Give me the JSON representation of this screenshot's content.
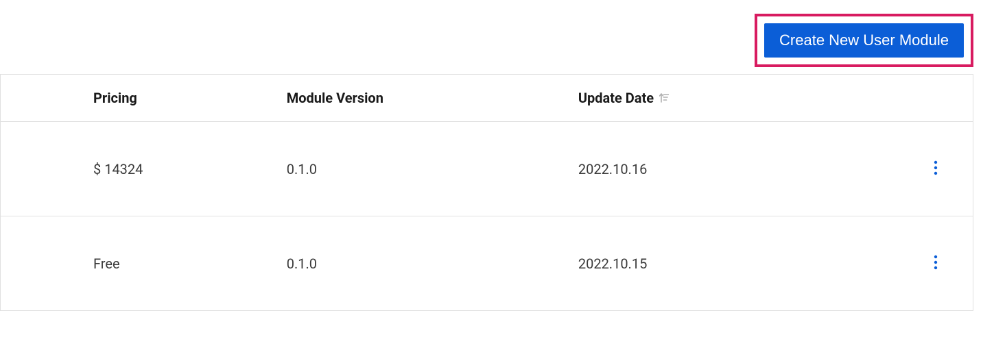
{
  "header": {
    "create_button_label": "Create New User Module"
  },
  "table": {
    "columns": {
      "pricing": "Pricing",
      "version": "Module Version",
      "update_date": "Update Date"
    },
    "rows": [
      {
        "pricing": "$ 14324",
        "version": "0.1.0",
        "update_date": "2022.10.16"
      },
      {
        "pricing": "Free",
        "version": "0.1.0",
        "update_date": "2022.10.15"
      }
    ]
  },
  "colors": {
    "primary": "#0b5ed7",
    "highlight": "#d81b60"
  }
}
